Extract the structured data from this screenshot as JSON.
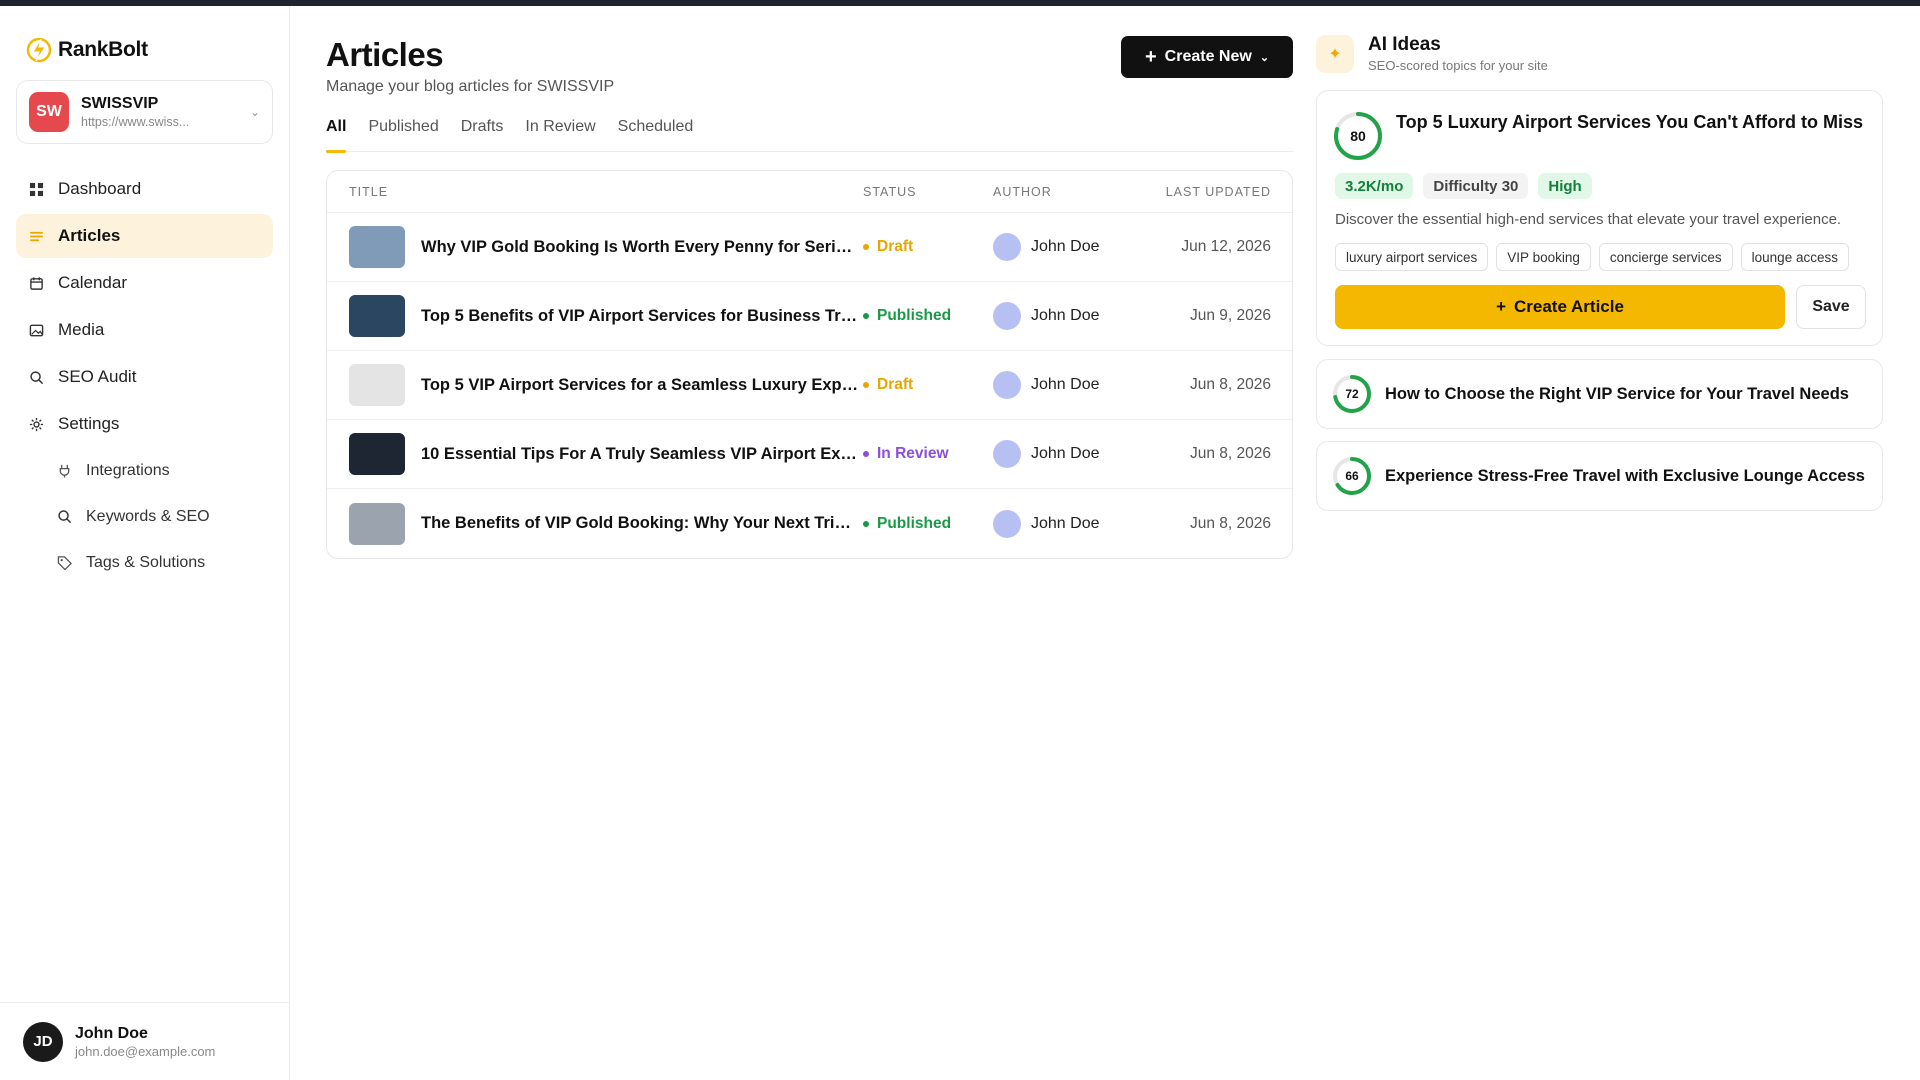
{
  "brand": {
    "name": "RankBolt"
  },
  "site": {
    "badge": "SW",
    "name": "SWISSVIP",
    "url": "https://www.swiss..."
  },
  "nav": [
    {
      "label": "Dashboard",
      "icon": "grid-icon"
    },
    {
      "label": "Articles",
      "icon": "list-icon",
      "active": true
    },
    {
      "label": "Calendar",
      "icon": "calendar-icon"
    },
    {
      "label": "Media",
      "icon": "image-icon"
    },
    {
      "label": "SEO Audit",
      "icon": "search-icon"
    },
    {
      "label": "Settings",
      "icon": "gear-icon"
    }
  ],
  "subnav": [
    {
      "label": "Integrations",
      "icon": "plug-icon"
    },
    {
      "label": "Keywords & SEO",
      "icon": "search-icon"
    },
    {
      "label": "Tags & Solutions",
      "icon": "tag-icon"
    }
  ],
  "user": {
    "initials": "JD",
    "name": "John Doe",
    "email": "john.doe@example.com"
  },
  "page": {
    "title": "Articles",
    "subtitle": "Manage your blog articles for SWISSVIP",
    "create_label": "Create New"
  },
  "tabs": [
    "All",
    "Published",
    "Drafts",
    "In Review",
    "Scheduled"
  ],
  "table": {
    "headers": [
      "TITLE",
      "STATUS",
      "AUTHOR",
      "LAST UPDATED"
    ],
    "rows": [
      {
        "title": "Why VIP Gold Booking Is Worth Every Penny for Seriou...",
        "status": "Draft",
        "author": "John Doe",
        "date": "Jun 12, 2026",
        "thumb": "#7f9bb8"
      },
      {
        "title": "Top 5 Benefits of VIP Airport Services for Business Tra...",
        "status": "Published",
        "author": "John Doe",
        "date": "Jun 9, 2026",
        "thumb": "#2b4660"
      },
      {
        "title": "Top 5 VIP Airport Services for a Seamless Luxury Expe...",
        "status": "Draft",
        "author": "John Doe",
        "date": "Jun 8, 2026",
        "thumb": "#e4e4e4"
      },
      {
        "title": "10 Essential Tips For A Truly Seamless VIP Airport Exp...",
        "status": "In Review",
        "author": "John Doe",
        "date": "Jun 8, 2026",
        "thumb": "#1e2633"
      },
      {
        "title": "The Benefits of VIP Gold Booking: Why Your Next Trip ...",
        "status": "Published",
        "author": "John Doe",
        "date": "Jun 8, 2026",
        "thumb": "#9aa3ae"
      }
    ]
  },
  "status_colors": {
    "Draft": "#e8a600",
    "Published": "#1a9a49",
    "In Review": "#8b4fd8"
  },
  "ai": {
    "title": "AI Ideas",
    "subtitle": "SEO-scored topics for your site",
    "featured": {
      "score": 80,
      "title": "Top 5 Luxury Airport Services You Can't Afford to Miss",
      "volume": "3.2K/mo",
      "difficulty": "Difficulty 30",
      "priority": "High",
      "description": "Discover the essential high-end services that elevate your travel experience.",
      "keywords": [
        "luxury airport services",
        "VIP booking",
        "concierge services",
        "lounge access"
      ],
      "create_label": "Create Article",
      "save_label": "Save"
    },
    "ideas": [
      {
        "score": 72,
        "title": "How to Choose the Right VIP Service for Your Travel Needs"
      },
      {
        "score": 66,
        "title": "Experience Stress-Free Travel with Exclusive Lounge Access"
      }
    ]
  },
  "colors": {
    "accent": "#f5b800",
    "score_ring": "#22a34a"
  }
}
